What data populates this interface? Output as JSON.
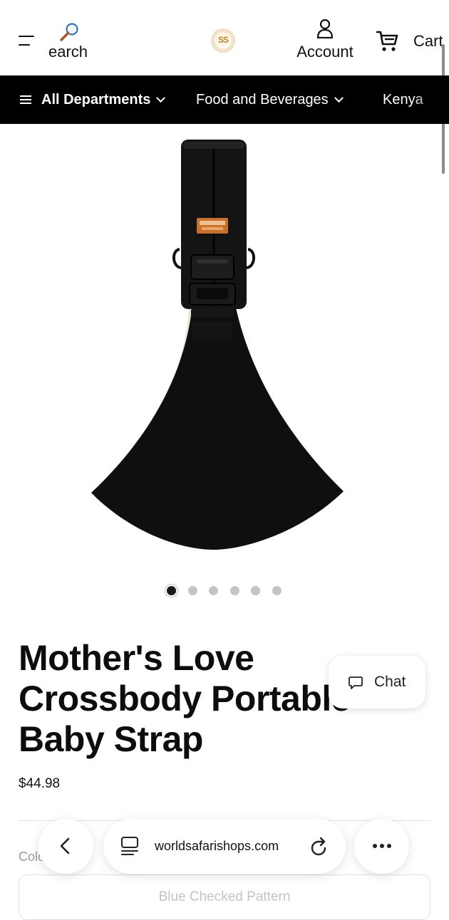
{
  "header": {
    "search_label": "earch",
    "account_label": "Account",
    "cart_label": "Cart",
    "logo_text": "SS"
  },
  "nav": {
    "items": [
      {
        "label": "All Departments"
      },
      {
        "label": "Food and Beverages"
      },
      {
        "label": "Kenya"
      }
    ]
  },
  "gallery": {
    "image_count": 6,
    "active_index": 0
  },
  "product": {
    "title_lines": [
      "Mother's Love",
      "Crossbody Portable",
      "Baby Strap"
    ],
    "price": "$44.98",
    "color_label": "Colo",
    "selected_variant": "Blue Checked Pattern"
  },
  "chat": {
    "label": "Chat"
  },
  "browser": {
    "url": "worldsafarishops.com"
  },
  "colors": {
    "nav_background": "#000000",
    "text": "#111111",
    "muted_text": "#c3c3c3",
    "product_black": "#0f0f0f",
    "badge_orange": "#c9702d"
  }
}
